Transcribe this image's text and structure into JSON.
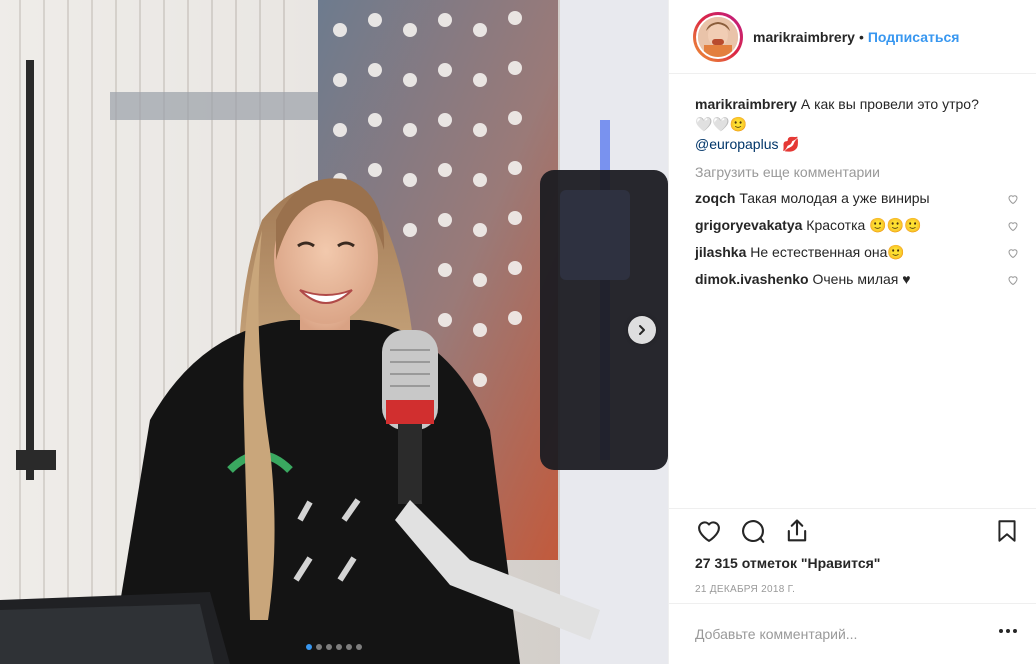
{
  "header": {
    "username": "marikraimbrery",
    "separator": "•",
    "follow_label": "Подписаться"
  },
  "caption": {
    "username": "marikraimbrery",
    "text": "А как вы провели это утро?",
    "emoji_line": "🤍🤍🙂",
    "mention": "@europaplus",
    "mention_emoji": "💋"
  },
  "load_more_label": "Загрузить еще комментарии",
  "comments": [
    {
      "user": "zoqch",
      "text": "Такая молодая а уже виниры"
    },
    {
      "user": "grigoryevakatya",
      "text": "Красотка 🙂🙂🙂"
    },
    {
      "user": "jilashka",
      "text": "Не естественная она🙂"
    },
    {
      "user": "dimok.ivashenko",
      "text": "Очень милая ♥"
    }
  ],
  "likes_text": "27 315 отметок \"Нравится\"",
  "date_text": "21 ДЕКАБРЯ 2018 Г.",
  "comment_input": {
    "placeholder": "Добавьте комментарий..."
  },
  "carousel": {
    "count": 6,
    "active": 0
  },
  "colors": {
    "accent": "#3897f0",
    "text": "#262626",
    "muted": "#999999",
    "border": "#efefef"
  },
  "icons": [
    "heart-icon",
    "comment-icon",
    "share-icon",
    "bookmark-icon",
    "chevron-right-icon",
    "more-options-icon"
  ]
}
